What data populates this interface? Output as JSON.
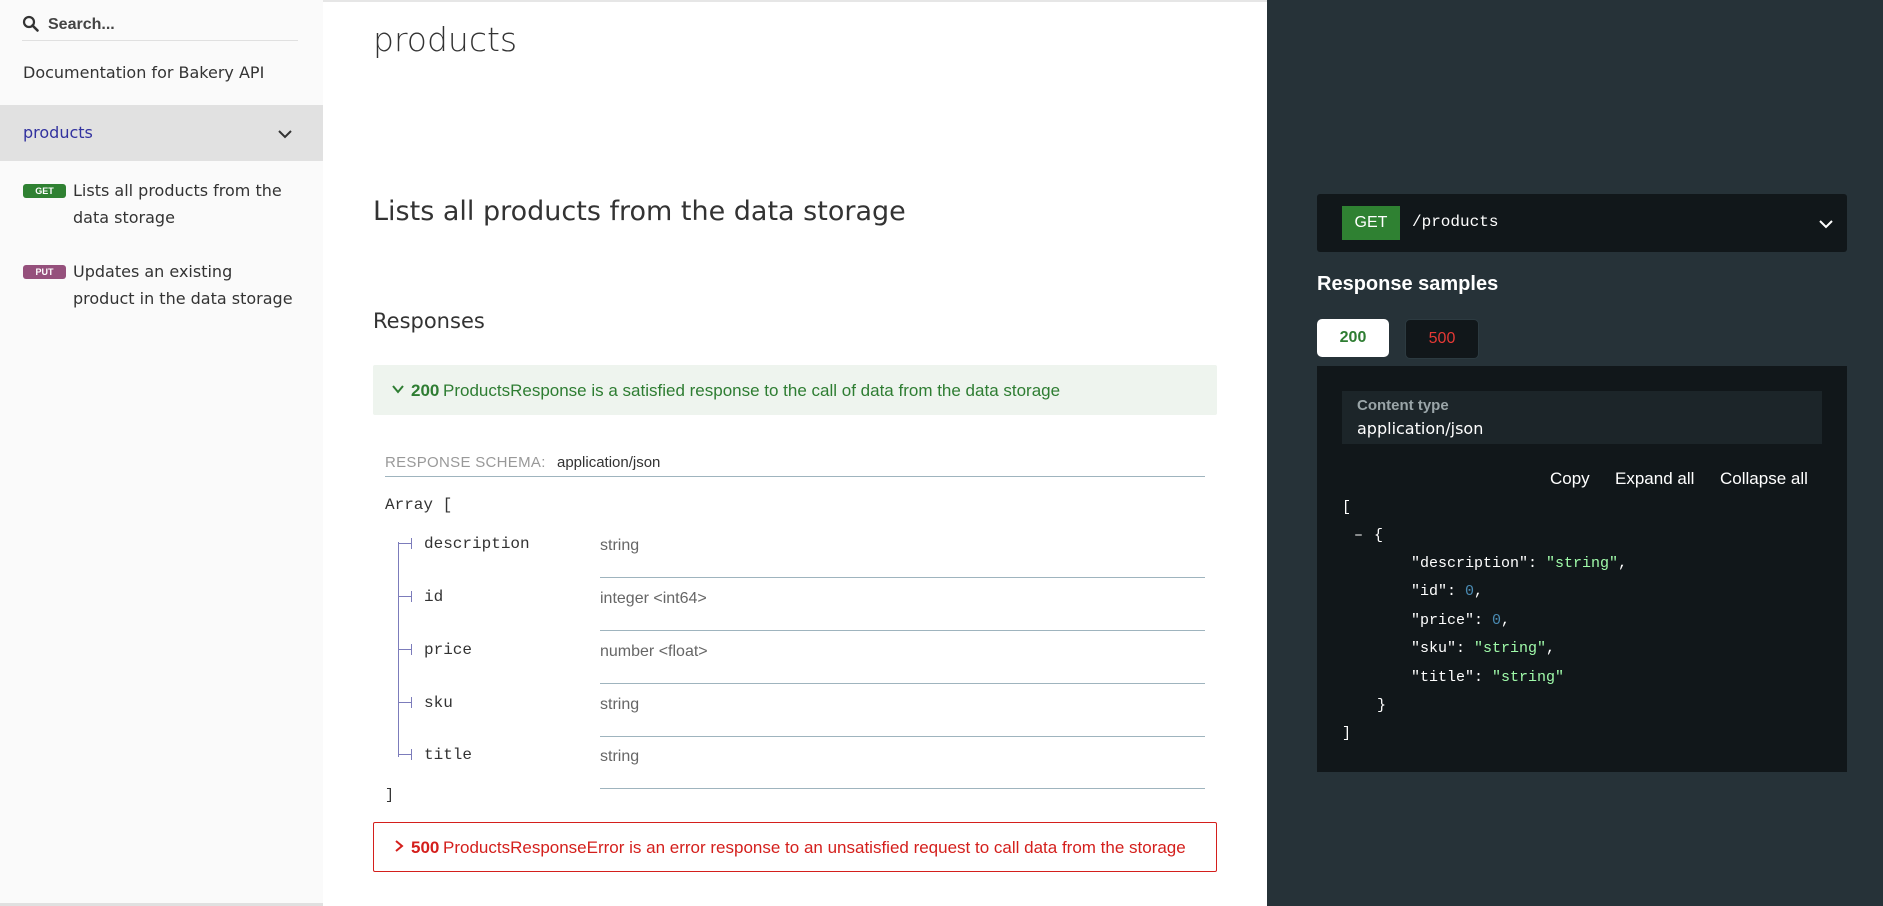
{
  "sidebar": {
    "search": {
      "placeholder": "Search..."
    },
    "doc_title": "Documentation for Bakery API",
    "group": {
      "label": "products"
    },
    "items": [
      {
        "method": "GET",
        "label": "Lists all products from the data storage"
      },
      {
        "method": "PUT",
        "label": "Updates an existing product in the data storage"
      }
    ]
  },
  "main": {
    "section_title": "products",
    "operation_title": "Lists all products from the data storage",
    "responses_title": "Responses",
    "response_200": {
      "code": "200",
      "description": "ProductsResponse is a satisfied response to the call of data from the data storage"
    },
    "schema": {
      "label": "RESPONSE SCHEMA:",
      "content_type": "application/json",
      "array_open": "Array [",
      "array_close": "]",
      "fields": [
        {
          "name": "description",
          "type": "string"
        },
        {
          "name": "id",
          "type": "integer <int64>"
        },
        {
          "name": "price",
          "type": "number <float>"
        },
        {
          "name": "sku",
          "type": "string"
        },
        {
          "name": "title",
          "type": "string"
        }
      ]
    },
    "response_500": {
      "code": "500",
      "description": "ProductsResponseError is an error response to an unsatisfied request to call data from the storage"
    }
  },
  "right_panel": {
    "endpoint": {
      "method": "GET",
      "path": "/products"
    },
    "samples_title": "Response samples",
    "tabs": [
      {
        "label": "200",
        "selected": true
      },
      {
        "label": "500",
        "selected": false
      }
    ],
    "content_type_label": "Content type",
    "content_type_value": "application/json",
    "toolbar": {
      "copy": "Copy",
      "expand": "Expand all",
      "collapse": "Collapse all"
    },
    "json": {
      "open_bracket": "[",
      "collapse_toggle": "–",
      "open_brace": "{",
      "lines": [
        {
          "key": "\"description\"",
          "value": "\"string\"",
          "kind": "string",
          "comma": ","
        },
        {
          "key": "\"id\"",
          "value": "0",
          "kind": "number",
          "comma": ","
        },
        {
          "key": "\"price\"",
          "value": "0",
          "kind": "number",
          "comma": ","
        },
        {
          "key": "\"sku\"",
          "value": "\"string\"",
          "kind": "string",
          "comma": ","
        },
        {
          "key": "\"title\"",
          "value": "\"string\"",
          "kind": "string",
          "comma": ""
        }
      ],
      "close_brace": "}",
      "close_bracket": "]"
    }
  },
  "colors": {
    "get": "#2f8132",
    "put": "#95507c",
    "success": "#2e7d32",
    "error": "#d41f1c",
    "right_bg": "#263238",
    "code_bg": "#11171a"
  }
}
